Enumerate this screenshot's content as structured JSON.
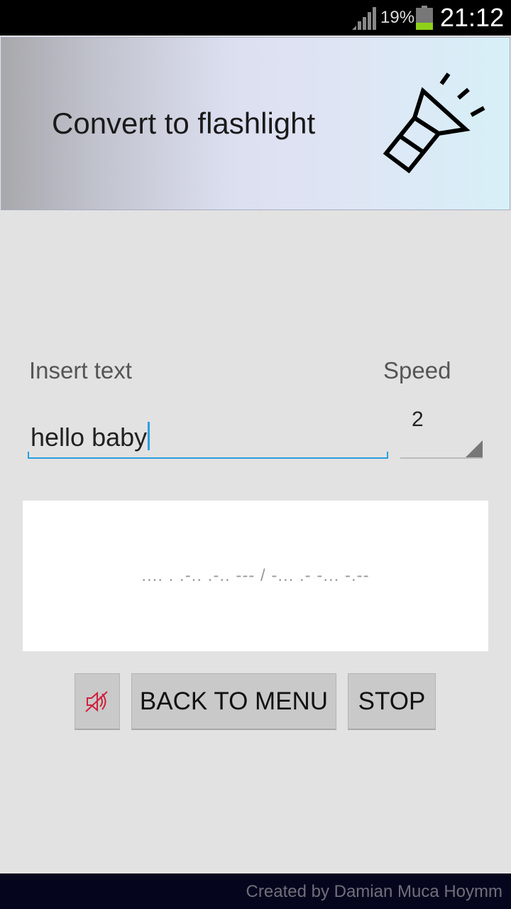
{
  "status_bar": {
    "battery_percent": "19%",
    "time": "21:12"
  },
  "header": {
    "title": "Convert to flashlight",
    "icon": "flashlight-icon"
  },
  "form": {
    "text_label": "Insert text",
    "text_value": "hello baby",
    "speed_label": "Speed",
    "speed_value": "2"
  },
  "output": {
    "morse": ".... . .-.. .-.. --- / -... .- -... -.--"
  },
  "buttons": {
    "mute_icon": "sound-off-icon",
    "back_label": "BACK TO MENU",
    "stop_label": "STOP"
  },
  "footer": {
    "credit": "Created by Damian Muca Hoymm"
  },
  "colors": {
    "accent": "#2b9ee0",
    "mute_icon": "#d0203a",
    "footer_bg": "#05051d"
  }
}
